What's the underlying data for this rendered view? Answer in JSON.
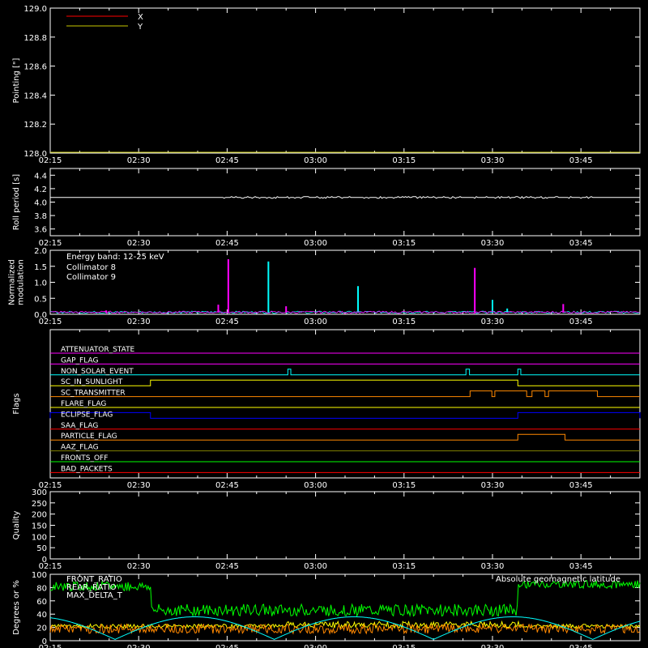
{
  "x_tick_labels": [
    "02:15",
    "02:30",
    "02:45",
    "03:00",
    "03:15",
    "03:30",
    "03:45"
  ],
  "x_tick_minutes": [
    135,
    150,
    165,
    180,
    195,
    210,
    225
  ],
  "x_range_minutes": [
    135,
    235
  ],
  "chart_data": [
    {
      "type": "line",
      "ylabel": "Pointing [\"]",
      "ylim": [
        128.0,
        129.0
      ],
      "y_tick_labels": [
        "128.0",
        "128.2",
        "128.4",
        "128.6",
        "128.8",
        "129.0"
      ],
      "y_ticks": [
        128.0,
        128.2,
        128.4,
        128.6,
        128.8,
        129.0
      ],
      "legend_placement": "top-left",
      "series": [
        {
          "name": "X",
          "color": "#ff0000",
          "x": [],
          "y": []
        },
        {
          "name": "Y",
          "color": "#c8c800",
          "x": [
            135,
            235
          ],
          "y": [
            128.0,
            128.0
          ]
        }
      ]
    },
    {
      "type": "line",
      "ylabel": "Roll period [s]",
      "ylim": [
        3.5,
        4.5
      ],
      "y_tick_labels": [
        "3.6",
        "3.8",
        "4.0",
        "4.2",
        "4.4"
      ],
      "y_ticks": [
        3.6,
        3.8,
        4.0,
        4.2,
        4.4
      ],
      "series": [
        {
          "name": "",
          "color": "#ffffff",
          "x": [
            135,
            145,
            150,
            160,
            165,
            175,
            180,
            190,
            195,
            205,
            210,
            220,
            226,
            235
          ],
          "y": [
            4.07,
            4.07,
            4.07,
            4.07,
            4.08,
            4.07,
            4.07,
            4.08,
            4.07,
            4.07,
            4.07,
            4.08,
            4.07,
            4.07
          ]
        }
      ]
    },
    {
      "type": "line",
      "ylabel": "Normalized modulation",
      "ylabel_lines": [
        "Normalized",
        "modulation"
      ],
      "ylim": [
        0.0,
        2.0
      ],
      "y_tick_labels": [
        "0.0",
        "0.5",
        "1.0",
        "1.5",
        "2.0"
      ],
      "y_ticks": [
        0.0,
        0.5,
        1.0,
        1.5,
        2.0
      ],
      "legend_title": "Energy band: 12-25 keV",
      "series": [
        {
          "name": "Collimator 8",
          "color": "#00ffff",
          "spikes_x": [
            172.0,
            187.2,
            210.0,
            212.5
          ],
          "spikes_y": [
            1.65,
            0.88,
            0.45,
            0.18
          ]
        },
        {
          "name": "Collimator 9",
          "color": "#ff00ff",
          "spikes_x": [
            165.2,
            207.0,
            144.5,
            163.5,
            175.0,
            222.0
          ],
          "spikes_y": [
            1.72,
            1.45,
            0.12,
            0.3,
            0.25,
            0.32
          ]
        }
      ]
    },
    {
      "type": "line",
      "ylabel": "Flags",
      "flags": [
        {
          "name": "ATTENUATOR_STATE",
          "color": "#ff00ff",
          "steps": []
        },
        {
          "name": "GAP_FLAG",
          "color": "#ff00ff",
          "steps": []
        },
        {
          "name": "NON_SOLAR_EVENT",
          "color": "#00ffff",
          "steps": [
            [
              175.3,
              175.8
            ],
            [
              205.5,
              206.1
            ],
            [
              214.3,
              214.8
            ]
          ]
        },
        {
          "name": "SC_IN_SUNLIGHT",
          "color": "#ffff00",
          "steps": [
            [
              152.0,
              214.3
            ]
          ]
        },
        {
          "name": "SC_TRANSMITTER",
          "color": "#ff8800",
          "steps": [
            [
              206.2,
              209.9
            ],
            [
              210.4,
              215.8
            ],
            [
              216.7,
              218.9
            ],
            [
              219.5,
              227.8
            ]
          ]
        },
        {
          "name": "FLARE_FLAG",
          "color": "#ffff00",
          "steps": []
        },
        {
          "name": "ECLIPSE_FLAG",
          "color": "#0000ff",
          "steps": [
            [
              135,
              152.0
            ],
            [
              214.3,
              235
            ]
          ]
        },
        {
          "name": "SAA_FLAG",
          "color": "#ff0000",
          "steps": []
        },
        {
          "name": "PARTICLE_FLAG",
          "color": "#ff8800",
          "steps": [
            [
              214.3,
              222.3
            ]
          ]
        },
        {
          "name": "AAZ_FLAG",
          "color": "#808000",
          "steps": []
        },
        {
          "name": "FRONTS_OFF",
          "color": "#00ff00",
          "steps": []
        },
        {
          "name": "BAD_PACKETS",
          "color": "#ff0000",
          "steps": []
        }
      ]
    },
    {
      "type": "line",
      "ylabel": "Quality",
      "ylim": [
        0,
        300
      ],
      "y_tick_labels": [
        "0",
        "50",
        "100",
        "150",
        "200",
        "250",
        "300"
      ],
      "y_ticks": [
        0,
        50,
        100,
        150,
        200,
        250,
        300
      ],
      "series": []
    },
    {
      "type": "line",
      "ylabel": "Degrees or %",
      "ylim": [
        0,
        100
      ],
      "y_tick_labels": [
        "0",
        "20",
        "40",
        "60",
        "80",
        "100"
      ],
      "y_ticks": [
        0,
        20,
        40,
        60,
        80,
        100
      ],
      "series": [
        {
          "name": "FRONT_RATIO",
          "color": "#ffff00"
        },
        {
          "name": "REAR_RATIO",
          "color": "#00ff00"
        },
        {
          "name": "MAX_DELTA_T",
          "color": "#ff8800"
        },
        {
          "name": "Absolute geomagnetic latitude",
          "color": "#00ffff"
        }
      ]
    }
  ]
}
